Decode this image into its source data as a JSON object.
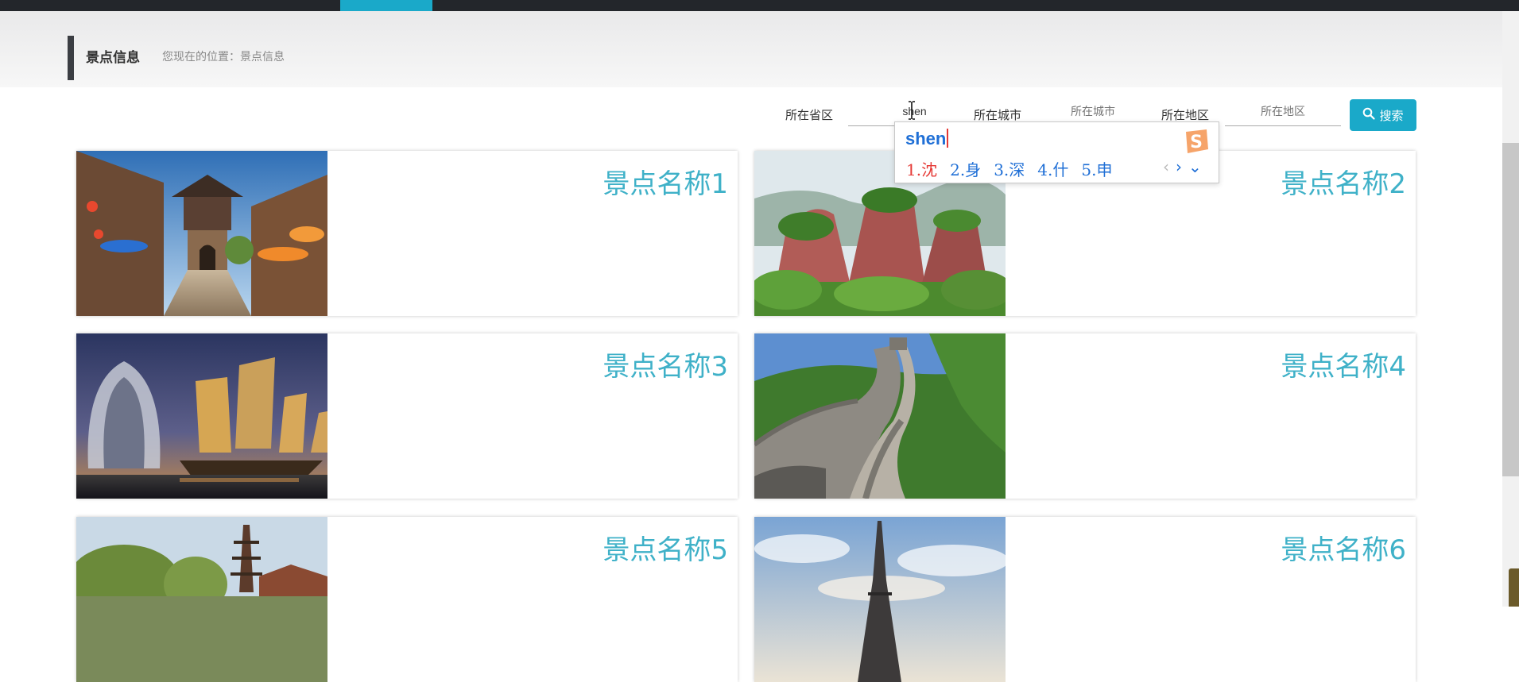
{
  "header": {
    "title": "景点信息",
    "breadcrumb": "您现在的位置：景点信息"
  },
  "search": {
    "province_label": "所在省区",
    "province_value": "shen",
    "city_label": "所在城市",
    "city_placeholder": "所在城市",
    "district_label": "所在地区",
    "district_placeholder": "所在地区",
    "button_label": "搜索"
  },
  "ime": {
    "composition": "shen",
    "candidates": [
      "1.沈",
      "2.身",
      "3.深",
      "4.什",
      "5.申"
    ],
    "nav": [
      "‹",
      "›",
      "⌄"
    ]
  },
  "cards": [
    {
      "name": "景点名称1"
    },
    {
      "name": "景点名称2"
    },
    {
      "name": "景点名称3"
    },
    {
      "name": "景点名称4"
    },
    {
      "name": "景点名称5"
    },
    {
      "name": "景点名称6"
    }
  ],
  "colors": {
    "accent": "#1aa9c9",
    "card_title": "#3fb1c8",
    "topbar": "#23262b"
  }
}
